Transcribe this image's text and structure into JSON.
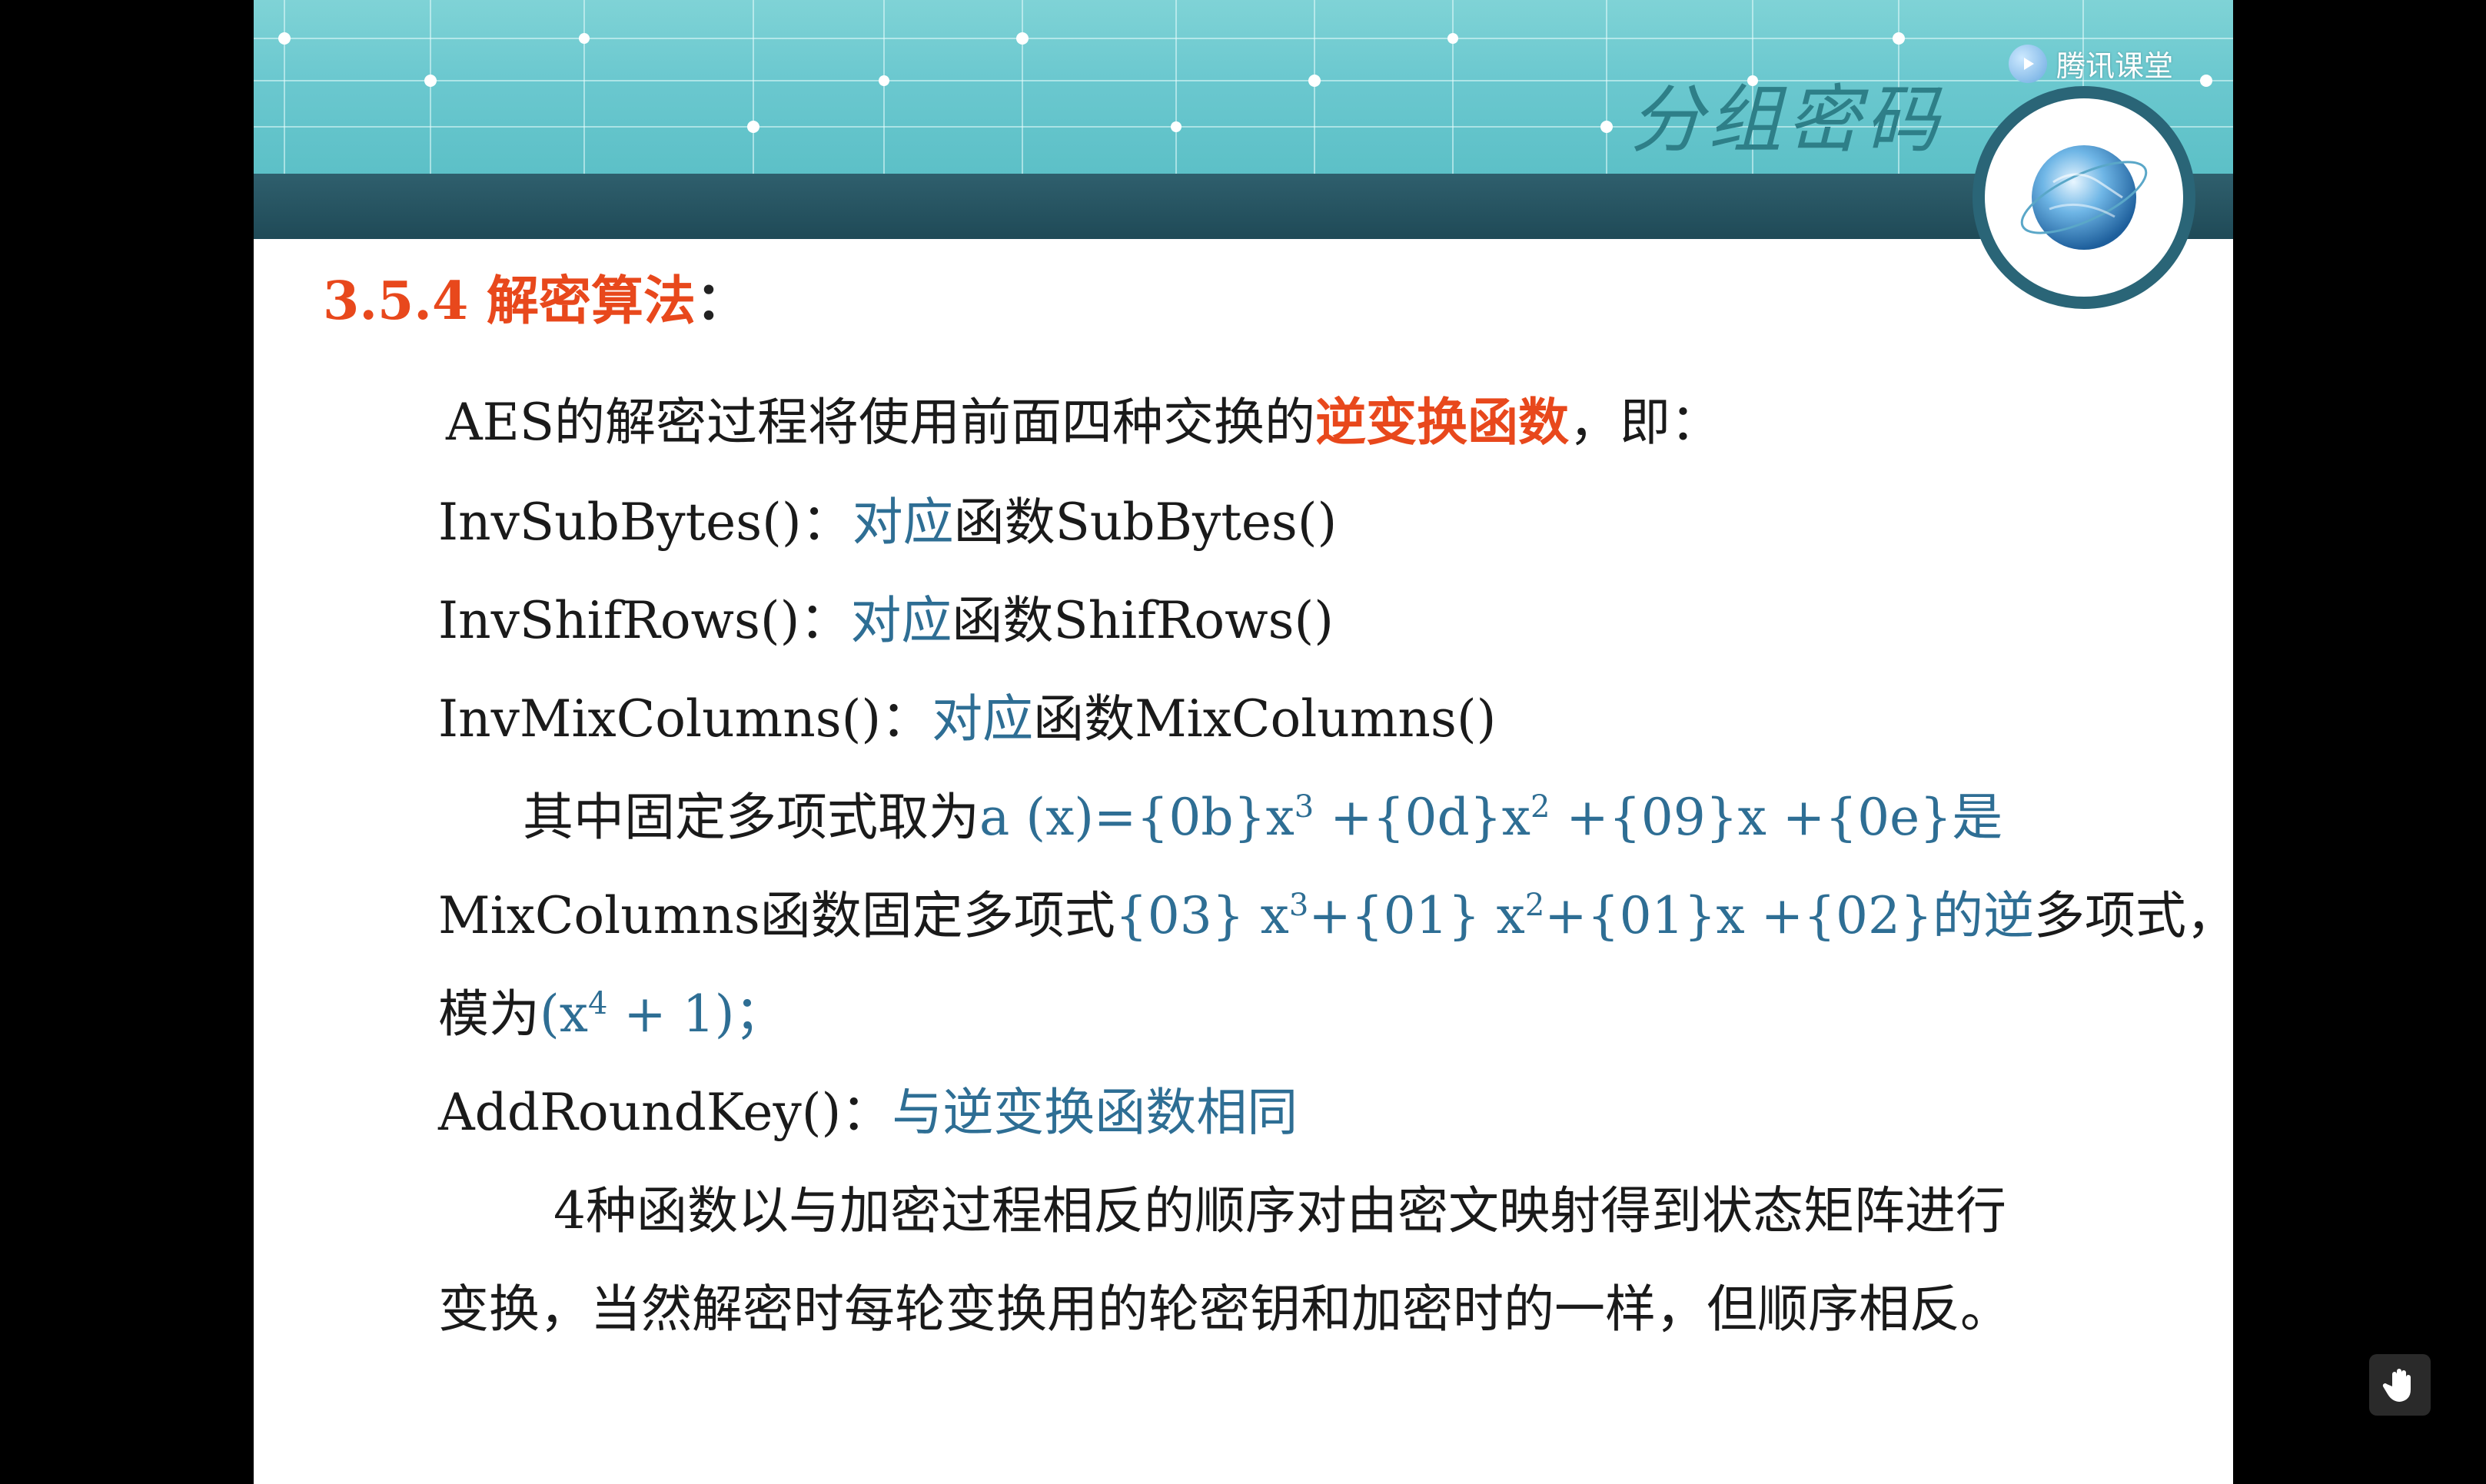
{
  "app": {
    "brand_name": "腾讯课堂"
  },
  "slide": {
    "course_title": "分组密码",
    "section": {
      "number": "3.5.4",
      "title": "解密算法",
      "colon": "："
    },
    "intro": {
      "text": "AES的解密过程将使用前面四种交换的",
      "highlight": "逆变换函数",
      "suffix": "，即："
    },
    "functions": [
      {
        "name": "InvSubBytes()：",
        "relation": "对应",
        "word": "函数",
        "counterpart": "SubBytes()"
      },
      {
        "name": "InvShifRows()：",
        "relation": "对应",
        "word": "函数",
        "counterpart": "ShifRows()"
      },
      {
        "name": "InvMixColumns()：",
        "relation": "对应",
        "word": "函数",
        "counterpart": "MixColumns()"
      }
    ],
    "poly": {
      "lead": "其中固定多项式取为",
      "ax": "a (x)={0b}x",
      "ax_p1": "3",
      "ax_2": " +{0d}x",
      "ax_p2": "2",
      "ax_3": " +{09}x +{0e}",
      "shi": "是",
      "mix_name": "MixColumns函数固定多项式",
      "m1": "{03} x",
      "m_p1": "3",
      "m2": "+{01} x",
      "m_p2": "2",
      "m3": "+{01}x +{02}",
      "of_inv": "的逆",
      "poly_word": "多项式，",
      "mod_label": "模为",
      "mod_a": "(x",
      "mod_p": "4",
      "mod_b": " + 1)",
      "mod_end": "；"
    },
    "addroundkey": {
      "name": "AddRoundKey()：",
      "desc": "与逆变换函数相同"
    },
    "summary": [
      "4种函数以与加密过程相反的顺序对由密文映射得到状态矩阵进行",
      "变换，当然解密时每轮变换用的轮密钥和加密时的一样，但顺序相反。"
    ]
  },
  "icons": {
    "brand": "play-icon",
    "globe": "globe-icon",
    "hand": "raise-hand-icon"
  },
  "colors": {
    "heading_red": "#e8481c",
    "text_blue": "#2e6e94",
    "banner_teal": "#6bc8cf",
    "band_dark": "#24505d"
  }
}
